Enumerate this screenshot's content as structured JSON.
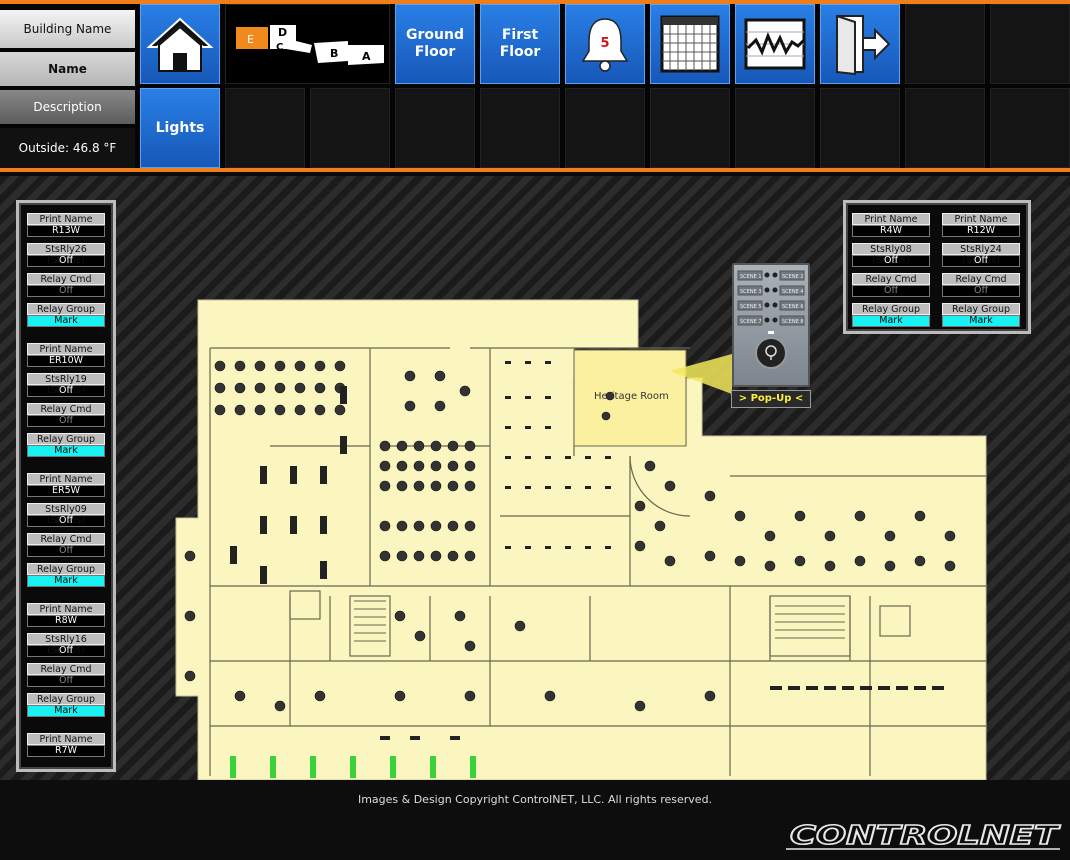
{
  "header": {
    "building_name": "Building Name",
    "name": "Name",
    "description": "Description",
    "outside_temp": "Outside: 46.8 °F"
  },
  "nav": {
    "home_icon": "home-icon",
    "campus_icon": "building-map-icon",
    "campus_labels": [
      "E",
      "D",
      "C",
      "B",
      "A"
    ],
    "ground_floor": "Ground Floor",
    "first_floor": "First Floor",
    "alarm_icon": "bell-icon",
    "alarm_count": "5",
    "schedule_icon": "calendar-icon",
    "trend_icon": "trend-chart-icon",
    "exit_icon": "exit-icon",
    "lights": "Lights"
  },
  "left_panel": [
    {
      "print_name_label": "Print Name",
      "print_name": "R13W",
      "status_label": "StsRly26 (Status)",
      "status": "Off",
      "cmd_label": "Relay Cmd",
      "cmd": "Off",
      "group_label": "Relay Group",
      "group": "Mark"
    },
    {
      "print_name_label": "Print Name",
      "print_name": "ER10W",
      "status_label": "StsRly19 (Status)",
      "status": "Off",
      "cmd_label": "Relay Cmd",
      "cmd": "Off",
      "group_label": "Relay Group",
      "group": "Mark"
    },
    {
      "print_name_label": "Print Name",
      "print_name": "ER5W",
      "status_label": "StsRly09 (Status)",
      "status": "Off",
      "cmd_label": "Relay Cmd",
      "cmd": "Off",
      "group_label": "Relay Group",
      "group": "Mark"
    },
    {
      "print_name_label": "Print Name",
      "print_name": "R8W",
      "status_label": "StsRly16 (Status)",
      "status": "Off",
      "cmd_label": "Relay Cmd",
      "cmd": "Off",
      "group_label": "Relay Group",
      "group": "Mark"
    },
    {
      "print_name_label": "Print Name",
      "print_name": "R7W"
    }
  ],
  "right_panel": [
    {
      "print_name_label": "Print Name",
      "print_name": "R4W",
      "status_label": "StsRly08 (Status)",
      "status": "Off",
      "cmd_label": "Relay Cmd",
      "cmd": "Off",
      "group_label": "Relay Group",
      "group": "Mark"
    },
    {
      "print_name_label": "Print Name",
      "print_name": "R12W",
      "status_label": "StsRly24 (Status)",
      "status": "Off",
      "cmd_label": "Relay Cmd",
      "cmd": "Off",
      "group_label": "Relay Group",
      "group": "Mark"
    }
  ],
  "floorplan": {
    "room_label": "Heritage Room"
  },
  "keypad": {
    "scene_labels": [
      "SCENE 1",
      "SCENE 2",
      "SCENE 3",
      "SCENE 4",
      "SCENE 5",
      "SCENE 6",
      "SCENE 7",
      "SCENE 8"
    ],
    "popup_label": "> Pop-Up <"
  },
  "footer": {
    "copyright": "Images & Design Copyright ControlNET, LLC. All rights reserved.",
    "logo_text": "CONTROLNET"
  },
  "colors": {
    "accent_orange": "#ef7d1a",
    "button_blue": "#1d6ad0",
    "relay_group_cyan": "#18f2f2",
    "floor_cream": "#fbf6c0"
  }
}
